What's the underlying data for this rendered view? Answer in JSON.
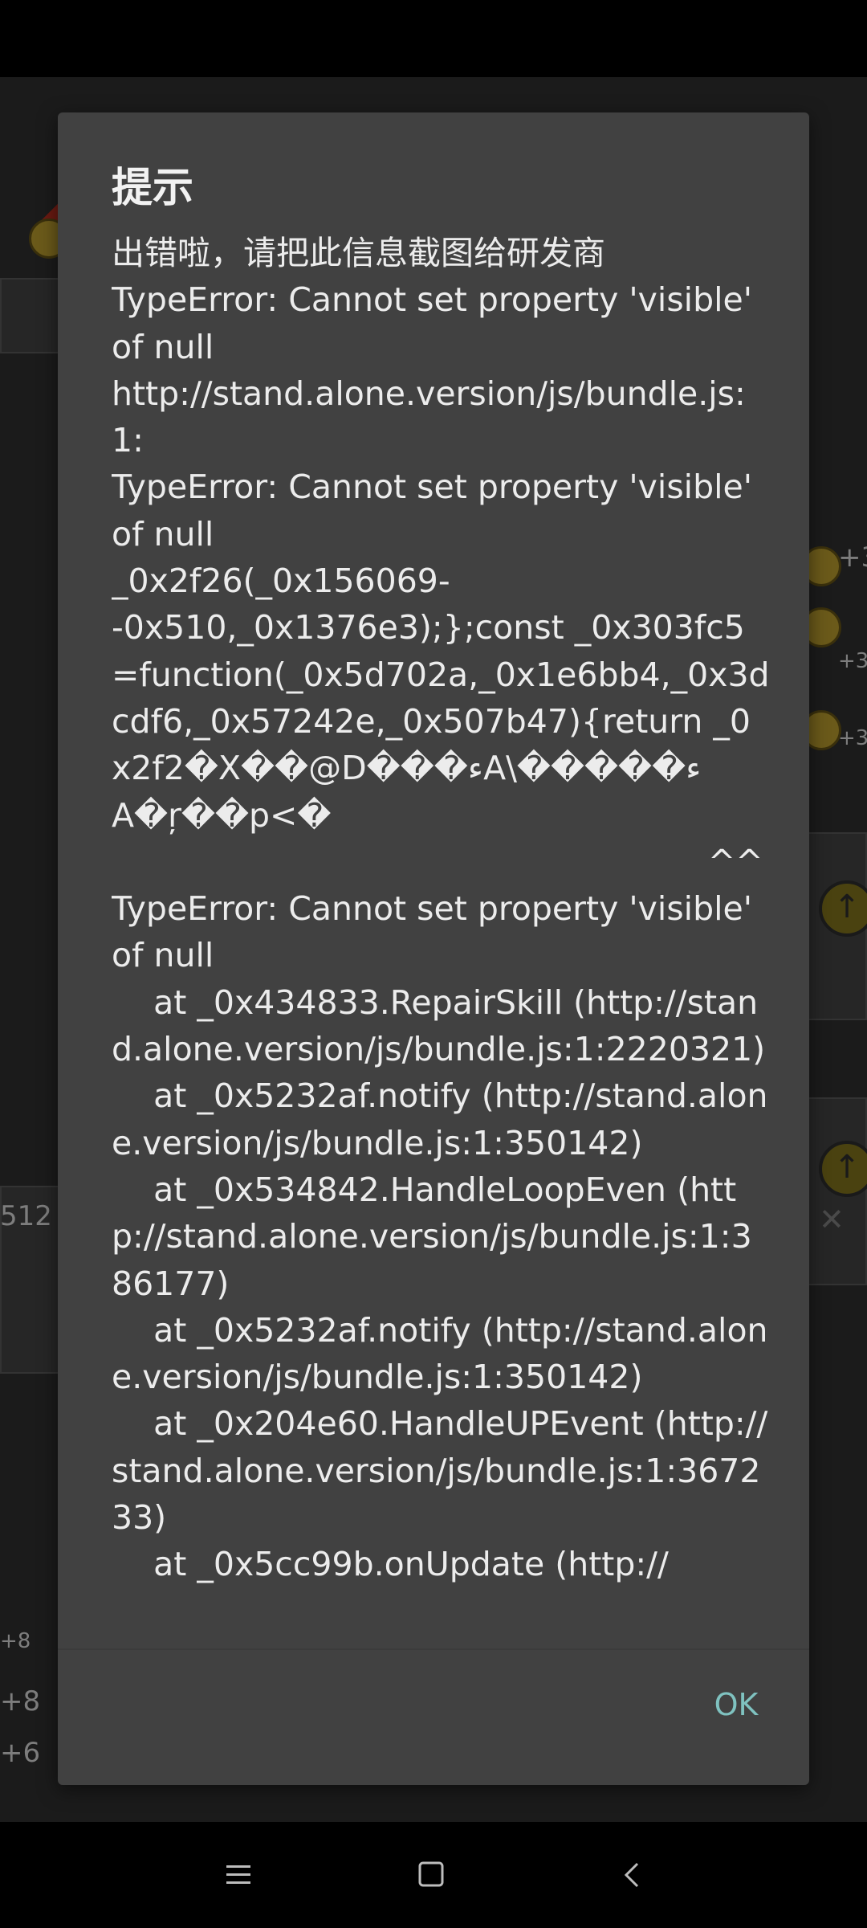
{
  "dialog": {
    "title": "提示",
    "message": "出错啦，请把此信息截图给研发商\nTypeError: Cannot set property 'visible' of null\nhttp://stand.alone.version/js/bundle.js:1:\nTypeError: Cannot set property 'visible' of null\n_0x2f26(_0x156069-\n-0x510,_0x1376e3);};const _0x303fc5=function(_0x5d702a,_0x1e6bb4,_0x3dcdf6,_0x57242e,_0x507b47){return _0x2f2�X��@D���ءA\\�����ء\nA�ŗ��p<�\n                                                         ^^\nTypeError: Cannot set property 'visible' of null\n    at _0x434833.RepairSkill (http://stand.alone.version/js/bundle.js:1:2220321)\n    at _0x5232af.notify (http://stand.alone.version/js/bundle.js:1:350142)\n    at _0x534842.HandleLoopEven (http://stand.alone.version/js/bundle.js:1:386177)\n    at _0x5232af.notify (http://stand.alone.version/js/bundle.js:1:350142)\n    at _0x204e60.HandleUPEvent (http://stand.alone.version/js/bundle.js:1:367233)\n    at _0x5cc99b.onUpdate (http://",
    "ok_label": "OK"
  },
  "background": {
    "left_numbers": [
      "512",
      "+8",
      "+8",
      "+6"
    ],
    "right_numbers": [
      "+3",
      "+3",
      "+3"
    ]
  },
  "nav": {
    "icons": [
      "menu-icon",
      "home-icon",
      "back-icon"
    ]
  },
  "colors": {
    "dialog_bg": "#414141",
    "accent": "#7fc2c0",
    "text": "#ececec"
  }
}
